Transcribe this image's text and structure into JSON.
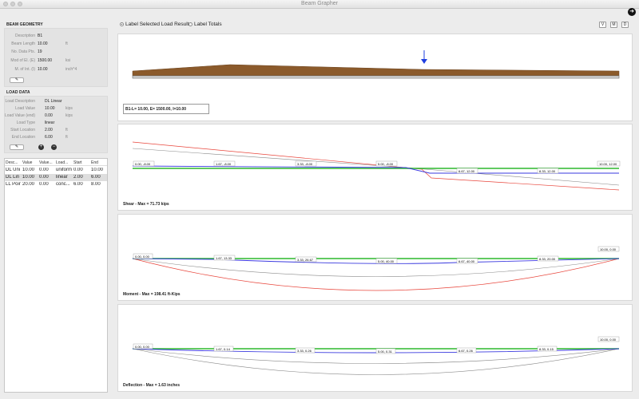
{
  "window": {
    "title": "Beam Grapher"
  },
  "beam_geometry": {
    "title": "BEAM GEOMETRY",
    "rows": [
      {
        "label": "Description",
        "value": "B1",
        "unit": ""
      },
      {
        "label": "Beam Length",
        "value": "10.00",
        "unit": "ft"
      },
      {
        "label": "No. Data Pts.",
        "value": "19",
        "unit": ""
      },
      {
        "label": "Mod of El. (E)",
        "value": "1500.00",
        "unit": "ksi"
      },
      {
        "label": "M. of Int. (I)",
        "value": "10.00",
        "unit": "inch^4"
      }
    ]
  },
  "load_data": {
    "title": "LOAD DATA",
    "rows": [
      {
        "label": "Load Description",
        "value": "DL Linear",
        "unit": ""
      },
      {
        "label": "Load Value",
        "value": "10.00",
        "unit": "kips"
      },
      {
        "label": "Load Value (end)",
        "value": "0.00",
        "unit": "kips"
      },
      {
        "label": "Load Type",
        "value": "linear",
        "unit": ""
      },
      {
        "label": "Start Location",
        "value": "2.00",
        "unit": "ft"
      },
      {
        "label": "End Location",
        "value": "6.00",
        "unit": "ft"
      }
    ]
  },
  "load_table": {
    "headers": [
      "Desc...",
      "Value",
      "Value...",
      "Load...",
      "Start",
      "End"
    ],
    "rows": [
      [
        "DL Uni",
        "10.00",
        "0.00",
        "uniform",
        "0.00",
        "10.00"
      ],
      [
        "DL Lin",
        "10.00",
        "0.00",
        "linear",
        "2.00",
        "6.00"
      ],
      [
        "LL Poir",
        "20.00",
        "0.00",
        "conc...",
        "6.00",
        "8.00"
      ]
    ]
  },
  "options": {
    "label_selected": "Label Selected Load Results",
    "label_totals": "Label Totals",
    "view_buttons": [
      "V",
      "M",
      "D"
    ]
  },
  "geometry_panel": {
    "caption": "B1-L= 10.00, E= 1500.00, I=10.00"
  },
  "shear": {
    "caption": "Shear - Max = 71.73 kips",
    "labels": [
      "0.00, -8.00",
      "1.67, -8.00",
      "3.33, -8.00",
      "5.00, -8.00",
      "6.67, 12.00",
      "8.33, 12.00",
      "10.00, 12.00"
    ]
  },
  "moment": {
    "caption": "Moment - Max = 198.41 ft-Kips",
    "labels": [
      "0.00, 0.00",
      "1.67, 13.33",
      "3.33, 26.67",
      "5.00, 40.00",
      "6.67, 40.00",
      "8.33, 20.00",
      "10.00, 0.00"
    ]
  },
  "deflection": {
    "caption": "Deflection - Max = 1.63 inches",
    "labels": [
      "0.00, 0.00",
      "1.67, 0.14",
      "3.33, 0.26",
      "5.00, 0.31",
      "6.67, 0.26",
      "8.33, 0.15",
      "10.00, 0.00"
    ]
  },
  "colors": {
    "beam_fill": "#8b5a2b",
    "selected": "#3a3adf",
    "total": "#e8463c",
    "other": "#2db82d",
    "neutral": "#888888",
    "load_arrow": "#1f3fe0"
  }
}
